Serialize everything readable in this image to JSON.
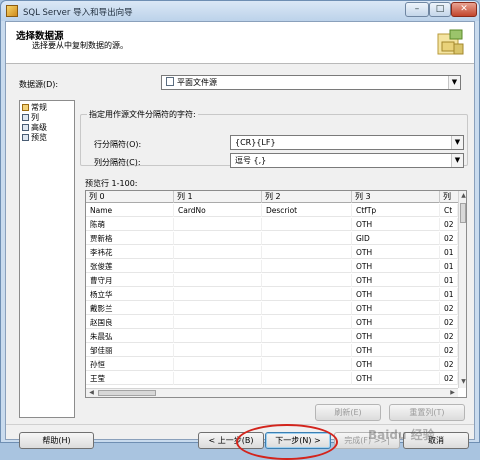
{
  "window": {
    "title": "SQL Server 导入和导出向导"
  },
  "titlebar_buttons": {
    "min": "–",
    "max": "□",
    "close": "✕"
  },
  "header": {
    "title": "选择数据源",
    "subtitle": "选择要从中复制数据的源。",
    "icon": "wizard-database-icon"
  },
  "datasource": {
    "label": "数据源(D):",
    "value": "平面文件源"
  },
  "nav": {
    "items": [
      "常规",
      "列",
      "高级",
      "预览"
    ],
    "selected": "常规"
  },
  "delimiter_group": {
    "title": "指定用作源文件分隔符的字符:",
    "row_label": "行分隔符(O):",
    "row_value": "{CR}{LF}",
    "col_label": "列分隔符(C):",
    "col_value": "逗号 {,}"
  },
  "preview": {
    "label": "预览行 1-100:",
    "columns": [
      "列 0",
      "列 1",
      "列 2",
      "列 3",
      "列"
    ],
    "rows": [
      [
        "Name",
        "CardNo",
        "Descriot",
        "CtfTp",
        "Ct"
      ],
      [
        "陈萌",
        "",
        "",
        "OTH",
        "02"
      ],
      [
        "贾新格",
        "",
        "",
        "GID",
        "02"
      ],
      [
        "李祎花",
        "",
        "",
        "OTH",
        "01"
      ],
      [
        "张俊莲",
        "",
        "",
        "OTH",
        "01"
      ],
      [
        "曹守月",
        "",
        "",
        "OTH",
        "01"
      ],
      [
        "杨立华",
        "",
        "",
        "OTH",
        "01"
      ],
      [
        "戴影兰",
        "",
        "",
        "OTH",
        "02"
      ],
      [
        "赵国良",
        "",
        "",
        "OTH",
        "02"
      ],
      [
        "朱晨弘",
        "",
        "",
        "OTH",
        "02"
      ],
      [
        "邹佳丽",
        "",
        "",
        "OTH",
        "02"
      ],
      [
        "孙恒",
        "",
        "",
        "OTH",
        "02"
      ],
      [
        "王莹",
        "",
        "",
        "OTH",
        "02"
      ]
    ]
  },
  "buttons": {
    "refresh": "刷新(E)",
    "reset_columns": "重置列(T)",
    "help": "帮助(H)",
    "back": "< 上一步(B)",
    "next": "下一步(N) >",
    "finish": "完成(F) >>|",
    "cancel": "取消"
  },
  "watermark": "Baidu 经验"
}
